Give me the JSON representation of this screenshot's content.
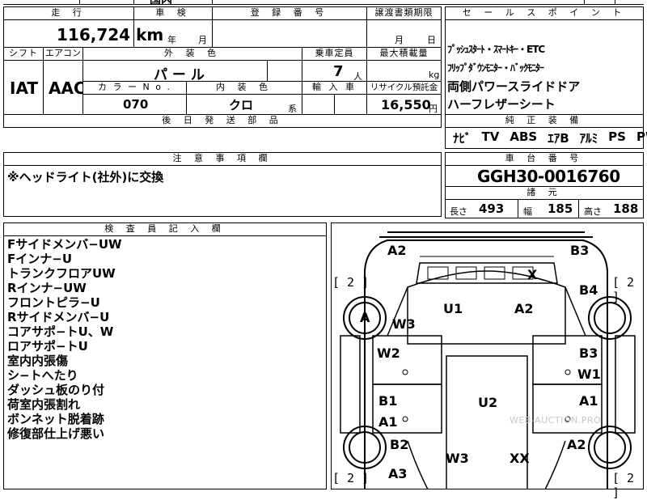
{
  "top_partial": "国内",
  "mileage": {
    "label": "走 行",
    "value": "116,724",
    "unit": "km"
  },
  "inspection": {
    "label": "車 検",
    "year_unit": "年",
    "month_unit": "月"
  },
  "registration": {
    "label": "登 録 番 号",
    "value": ""
  },
  "transfer_deadline": {
    "label": "譲渡書類期限",
    "month_unit": "月",
    "day_unit": "日"
  },
  "shift": {
    "label": "シフト",
    "value": "IAT"
  },
  "aircon": {
    "label": "エアコン",
    "value": "AAC"
  },
  "exterior_color": {
    "label": "外 装 色",
    "value": "パ ー ル"
  },
  "capacity": {
    "label": "乗車定員",
    "value": "7",
    "unit": "人"
  },
  "max_load": {
    "label": "最大積載量",
    "unit": "kg"
  },
  "color_no": {
    "label": "カ ラ ー  N o .",
    "value": "070"
  },
  "interior_color": {
    "label": "内 装 色",
    "value": "クロ",
    "suffix": "系"
  },
  "import_car": {
    "label": "輸 入 車"
  },
  "recycle": {
    "label": "リサイクル預託金",
    "value": "16,550",
    "unit": "円"
  },
  "later_parts": {
    "label": "後 日 発 送 部 品"
  },
  "sales_points": {
    "label": "セ ー ル ス ポ イ ン ト",
    "lines": [
      "ﾌﾟｯｼｭｽﾀｰﾄ・ｽﾏｰﾄｷｰ・ETC",
      "ﾌﾘｯﾌﾟﾀﾞｳﾝﾓﾆﾀｰ・ﾊﾞｯｸﾓﾆﾀｰ",
      "両側パワースライドドア",
      "ハーフレザーシート"
    ]
  },
  "equipment": {
    "label": "純 正 装 備",
    "items": [
      "ﾅﾋﾞ",
      "TV",
      "ABS",
      "ｴｱB",
      "ｱﾙﾐ",
      "PS",
      "PW"
    ]
  },
  "caution": {
    "label": "注 意 事 項 欄",
    "text": "※ヘッドライト(社外)に交換"
  },
  "chassis": {
    "label": "車 台 番 号",
    "value": "GGH30-0016760"
  },
  "specs": {
    "label": "諸 元",
    "length_label": "長さ",
    "length": "493",
    "width_label": "幅",
    "width": "185",
    "height_label": "高さ",
    "height": "188"
  },
  "inspector": {
    "label": "検 査 員 記 入 欄",
    "lines": [
      "Fサイドメンバ−UW",
      "Fインナ−U",
      "トランクフロアUW",
      "Rインナ−UW",
      "フロントピラ−U",
      "Rサイドメンバ−U",
      "コアサポ−トU、W",
      "ロアサポ−トU",
      "室内内張傷",
      "シ−トへたり",
      "ダッシュ板のり付",
      "荷室内張割れ",
      "ボンネット脱着跡",
      "修復部仕上げ悪い"
    ]
  },
  "diagram": {
    "watermark": "WEB-AUCTION.PRO",
    "labels": {
      "a2_top": "A2",
      "b3_top": "B3",
      "x_top": "X",
      "b4": "B4",
      "a_wheel": "A",
      "w3_left": "W3",
      "u1": "U1",
      "a2_roof": "A2",
      "w2": "W2",
      "b3_right": "B3",
      "w1": "W1",
      "b1": "B1",
      "a1_left": "A1",
      "u2": "U2",
      "a1_right": "A1",
      "b2": "B2",
      "w3_bottom": "W3",
      "xx": "XX",
      "a2_right": "A2",
      "a3": "A3"
    },
    "tire_counts": {
      "front_left": "[ 2 ]",
      "front_right": "[ 2 ]",
      "rear_left": "[ 2 ]",
      "rear_right": "[ 2 ]"
    }
  }
}
